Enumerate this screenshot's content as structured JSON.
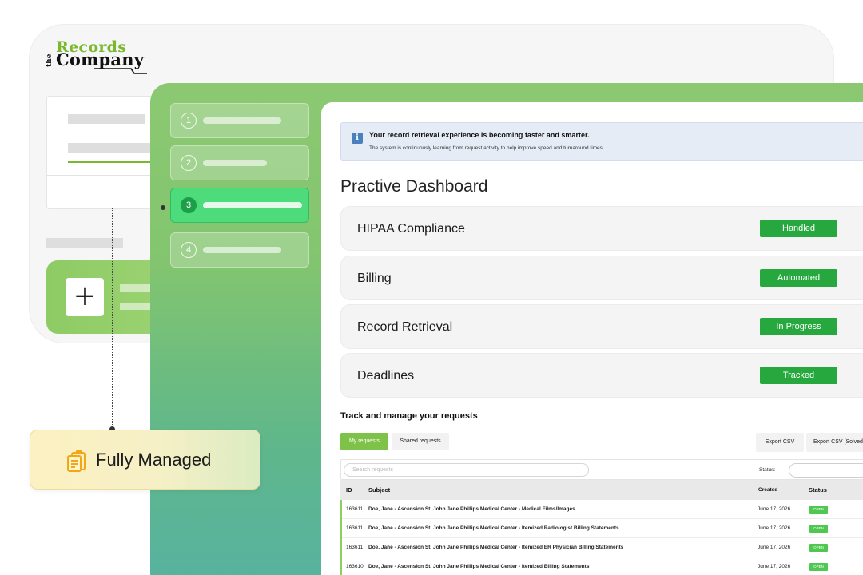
{
  "brand": {
    "logo_the": "the",
    "logo_records": "Records",
    "logo_company": "Company"
  },
  "steps": [
    {
      "number": "1",
      "active": false
    },
    {
      "number": "2",
      "active": false
    },
    {
      "number": "3",
      "active": true
    },
    {
      "number": "4",
      "active": false
    }
  ],
  "banner": {
    "icon": "i",
    "title": "Your record retrieval experience is becoming faster and smarter.",
    "text": "The system is continuously learning from request activity to help improve speed and turnaround times."
  },
  "dashboard": {
    "title": "Practive Dashboard"
  },
  "compliance_rows": [
    {
      "label": "HIPAA Compliance",
      "badge": "Handled"
    },
    {
      "label": "Billing",
      "badge": "Automated"
    },
    {
      "label": "Record Retrieval",
      "badge": "In Progress"
    },
    {
      "label": "Deadlines",
      "badge": "Tracked"
    }
  ],
  "requests": {
    "title": "Track and manage your requests",
    "tabs": {
      "mine": "My requests",
      "shared": "Shared requests"
    },
    "export_csv": "Export CSV",
    "export_csv_solved": "Export CSV [Solved]",
    "search_placeholder": "Search requests",
    "status_label": "Status:",
    "columns": {
      "id": "ID",
      "subject": "Subject",
      "created": "Created",
      "status": "Status"
    },
    "rows": [
      {
        "id": "163611",
        "subject": "Doe, Jane - Ascension St. John Jane Phillips Medical Center - Medical Films/Images",
        "created": "June 17, 2026",
        "status": "OPEN"
      },
      {
        "id": "163611",
        "subject": "Doe, Jane - Ascension St. John Jane Phillips Medical Center - Itemized Radiologist Billing Statements",
        "created": "June 17, 2026",
        "status": "OPEN"
      },
      {
        "id": "163611",
        "subject": "Doe, Jane - Ascension St. John Jane Phillips Medical Center - Itemized ER Physician Billing Statements",
        "created": "June 17, 2026",
        "status": "OPEN"
      },
      {
        "id": "163610",
        "subject": "Doe, Jane - Ascension St. John Jane Phillips Medical Center - Itemized Billing Statements",
        "created": "June 17, 2026",
        "status": "OPEN"
      }
    ]
  },
  "badge": {
    "icon": "clipboard-icon",
    "label": "Fully Managed"
  },
  "colors": {
    "brand_green": "#7ab830",
    "status_green": "#27a83f",
    "active_step": "#4ddb7c",
    "banner_bg": "#e6ecf6",
    "badge_yellow": "#fcf1c2"
  }
}
